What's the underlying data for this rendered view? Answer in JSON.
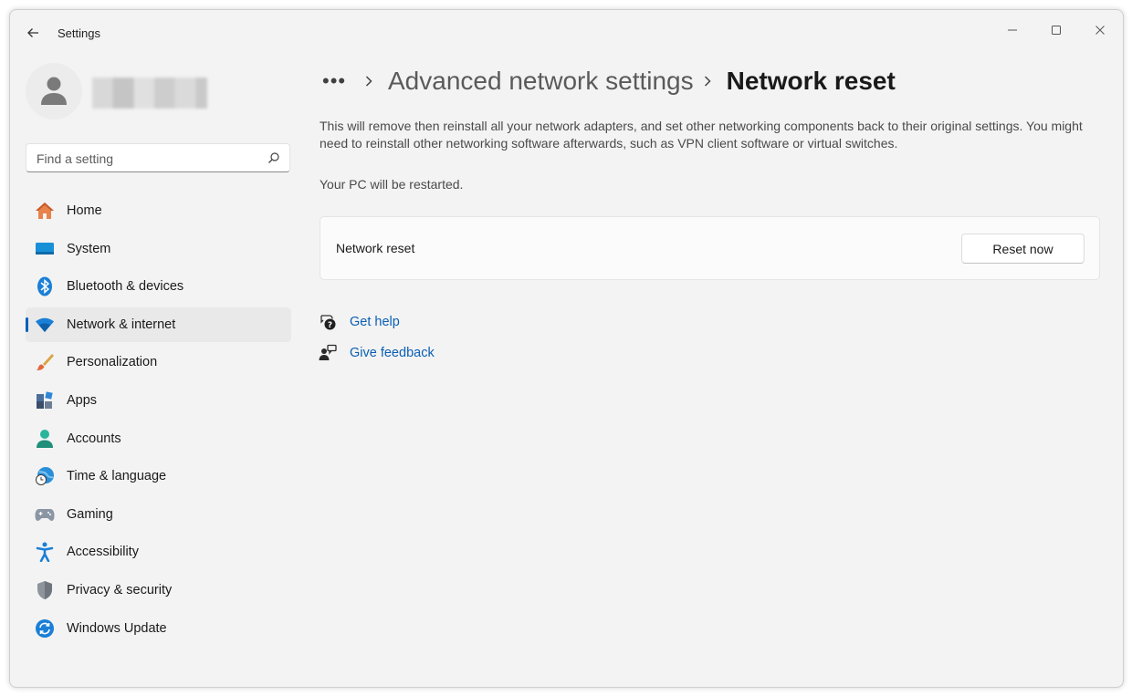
{
  "window": {
    "title": "Settings",
    "controls": {
      "minimize": "minimize-icon",
      "maximize": "maximize-icon",
      "close": "close-icon"
    }
  },
  "profile": {
    "name": "████████"
  },
  "search": {
    "placeholder": "Find a setting"
  },
  "sidebar": {
    "items": [
      {
        "label": "Home",
        "icon": "home-icon"
      },
      {
        "label": "System",
        "icon": "system-icon"
      },
      {
        "label": "Bluetooth & devices",
        "icon": "bluetooth-icon"
      },
      {
        "label": "Network & internet",
        "icon": "wifi-icon",
        "selected": true
      },
      {
        "label": "Personalization",
        "icon": "brush-icon"
      },
      {
        "label": "Apps",
        "icon": "apps-icon"
      },
      {
        "label": "Accounts",
        "icon": "accounts-icon"
      },
      {
        "label": "Time & language",
        "icon": "globe-clock-icon"
      },
      {
        "label": "Gaming",
        "icon": "gamepad-icon"
      },
      {
        "label": "Accessibility",
        "icon": "accessibility-icon"
      },
      {
        "label": "Privacy & security",
        "icon": "shield-icon"
      },
      {
        "label": "Windows Update",
        "icon": "update-icon"
      }
    ]
  },
  "main": {
    "breadcrumb": {
      "more": "•••",
      "parent": "Advanced network settings",
      "current": "Network reset"
    },
    "description": "This will remove then reinstall all your network adapters, and set other networking components back to their original settings. You might need to reinstall other networking software afterwards, such as VPN client software or virtual switches.",
    "restart_note": "Your PC will be restarted.",
    "card": {
      "label": "Network reset",
      "button": "Reset now"
    },
    "links": [
      {
        "label": "Get help",
        "icon": "help-icon"
      },
      {
        "label": "Give feedback",
        "icon": "feedback-icon"
      }
    ]
  },
  "colors": {
    "accent": "#005fb8",
    "link": "#0a5fb4",
    "window_bg": "#f3f3f3",
    "selected_bg": "#e9e9e9"
  }
}
